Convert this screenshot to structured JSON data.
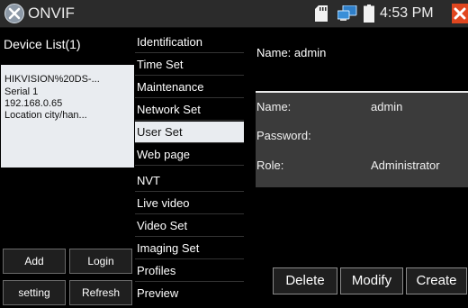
{
  "status_bar": {
    "app_title": "ONVIF",
    "time": "4:53 PM",
    "icons": [
      "onvif-logo-icon",
      "sd-card-icon",
      "network-icon",
      "battery-icon",
      "close-icon"
    ]
  },
  "left_panel": {
    "title": "Device List(1)",
    "device": {
      "name": "HIKVISION%20DS-...",
      "serial": "Serial  1",
      "ip": "192.168.0.65",
      "location": "Location  city/han..."
    },
    "buttons": {
      "add": "Add",
      "login": "Login",
      "setting": "setting",
      "refresh": "Refresh"
    }
  },
  "menu": {
    "items": [
      {
        "label": "Identification"
      },
      {
        "label": "Time Set"
      },
      {
        "label": "Maintenance"
      },
      {
        "label": "Network Set"
      },
      {
        "label": "User Set"
      },
      {
        "label": "Web page"
      },
      {
        "label": "NVT"
      },
      {
        "label": "Live video"
      },
      {
        "label": "Video Set"
      },
      {
        "label": "Imaging Set"
      },
      {
        "label": "Profiles"
      },
      {
        "label": "Preview"
      }
    ],
    "selected": "User Set"
  },
  "user_panel": {
    "top_name": "Name: admin",
    "name_label": "Name:",
    "name_value": "admin",
    "password_label": "Password:",
    "password_value": "",
    "role_label": "Role:",
    "role_value": "Administrator"
  },
  "actions": {
    "delete": "Delete",
    "modify": "Modify",
    "create": "Create"
  },
  "colors": {
    "background": "#000000",
    "status_bar": "#2b2b2b",
    "selected_bg": "#e9ecf0",
    "user_panel_bg": "#3b3b3b",
    "close_button": "#e0461f"
  }
}
